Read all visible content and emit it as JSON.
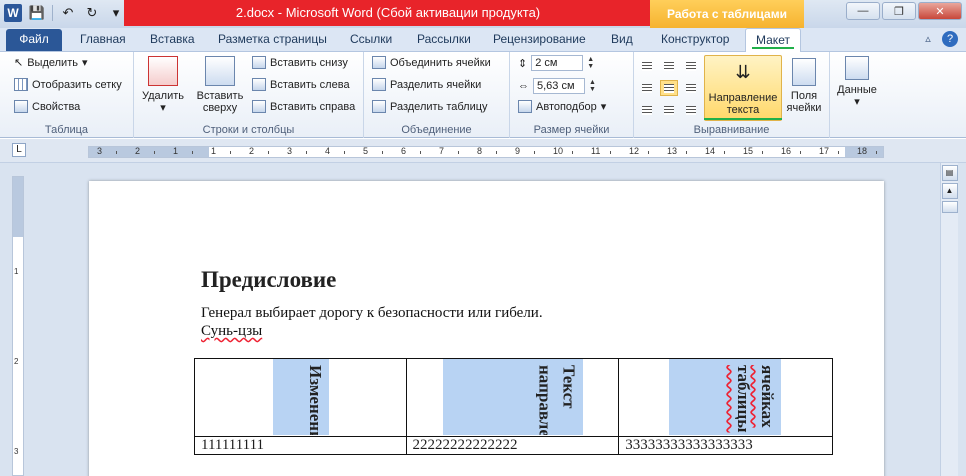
{
  "title_bar": {
    "doc_title": "2.docx  -  Microsoft Word (Сбой активации продукта)",
    "context_group": "Работа с таблицами",
    "quick_access": [
      "W",
      "💾",
      "↶",
      "↻",
      "▾"
    ]
  },
  "tabs": [
    {
      "label": "Файл"
    },
    {
      "label": "Главная"
    },
    {
      "label": "Вставка"
    },
    {
      "label": "Разметка страницы"
    },
    {
      "label": "Ссылки"
    },
    {
      "label": "Рассылки"
    },
    {
      "label": "Рецензирование"
    },
    {
      "label": "Вид"
    },
    {
      "label": "Конструктор"
    },
    {
      "label": "Макет"
    }
  ],
  "ribbon": {
    "table_group": {
      "label": "Таблица",
      "select": "Выделить",
      "show_grid": "Отобразить сетку",
      "properties": "Свойства"
    },
    "rows_cols_group": {
      "label": "Строки и столбцы",
      "delete": "Удалить",
      "insert_above_1": "Вставить",
      "insert_above_2": "сверху",
      "insert_below": "Вставить снизу",
      "insert_left": "Вставить слева",
      "insert_right": "Вставить справа"
    },
    "merge_group": {
      "label": "Объединение",
      "merge_cells": "Объединить ячейки",
      "split_cells": "Разделить ячейки",
      "split_table": "Разделить таблицу"
    },
    "cell_size_group": {
      "label": "Размер ячейки",
      "height": "2 см",
      "width": "5,63 см",
      "autofit": "Автоподбор"
    },
    "alignment_group": {
      "label": "Выравнивание",
      "text_direction_1": "Направление",
      "text_direction_2": "текста",
      "cell_margins_1": "Поля",
      "cell_margins_2": "ячейки"
    },
    "data_group": {
      "label": "Данные"
    }
  },
  "ruler": {
    "numbers": [
      "3",
      "2",
      "1",
      "1",
      "2",
      "3",
      "4",
      "5",
      "6",
      "7",
      "8",
      "9",
      "10",
      "11",
      "12",
      "13",
      "14",
      "15",
      "16",
      "17",
      "18"
    ],
    "vertical_numbers": [
      "1",
      "2",
      "3"
    ]
  },
  "document": {
    "heading": "Предисловие",
    "line1": "Генерал выбирает дорогу к безопасности или гибели.",
    "line2": "Сунь-цзы",
    "table": {
      "row1": [
        "Изменение",
        "Текст направление",
        "ячейках таблицы"
      ],
      "row2": [
        "111111111",
        "22222222222222",
        "33333333333333333"
      ]
    }
  },
  "colors": {
    "title_red": "#e8242a",
    "context_orange": "#f6b32f",
    "file_tab": "#2b5797",
    "highlight_green": "#20b04a",
    "cell_blue": "#b8d3f3"
  }
}
